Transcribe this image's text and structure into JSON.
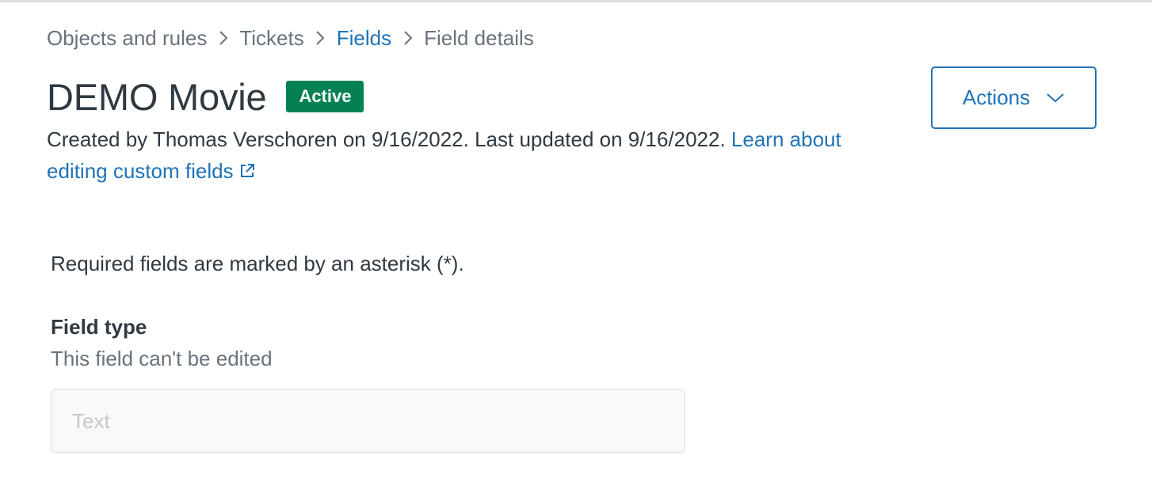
{
  "breadcrumb": {
    "items": [
      {
        "label": "Objects and rules"
      },
      {
        "label": "Tickets"
      },
      {
        "label": "Fields"
      },
      {
        "label": "Field details"
      }
    ]
  },
  "header": {
    "title": "DEMO Movie",
    "status": "Active",
    "meta_text": "Created by Thomas Verschoren on 9/16/2022. Last updated on 9/16/2022.",
    "learn_link": "Learn about editing custom fields",
    "actions_label": "Actions"
  },
  "form": {
    "required_note": "Required fields are marked by an asterisk (*).",
    "field_type": {
      "label": "Field type",
      "hint": "This field can't be edited",
      "value": "Text"
    }
  },
  "colors": {
    "link": "#1f73b7",
    "badge_active": "#038153",
    "text_primary": "#2f3941",
    "text_secondary": "#68737d"
  },
  "icons": {
    "breadcrumb_separator": "chevron-right-icon",
    "actions_dropdown": "chevron-down-icon",
    "external_link": "external-link-icon"
  }
}
